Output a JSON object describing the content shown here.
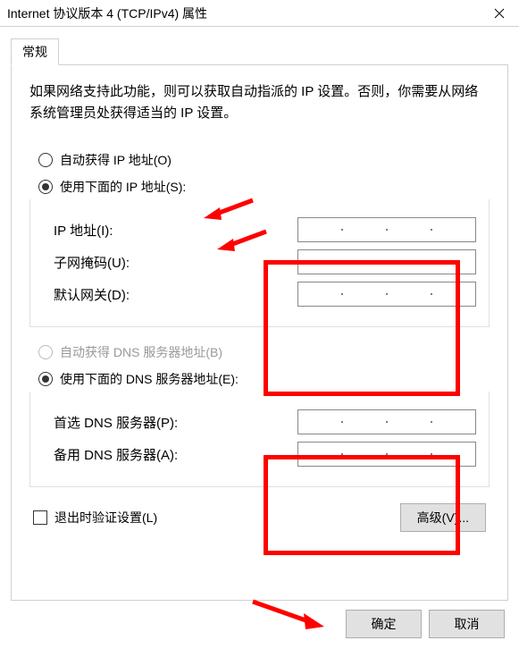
{
  "window": {
    "title": "Internet 协议版本 4 (TCP/IPv4) 属性"
  },
  "tab": {
    "general": "常规"
  },
  "description": "如果网络支持此功能，则可以获取自动指派的 IP 设置。否则，你需要从网络系统管理员处获得适当的 IP 设置。",
  "ip_section": {
    "auto_radio": "自动获得 IP 地址(O)",
    "manual_radio": "使用下面的 IP 地址(S):",
    "ip_address_label": "IP 地址(I):",
    "subnet_label": "子网掩码(U):",
    "gateway_label": "默认网关(D):"
  },
  "dns_section": {
    "auto_radio": "自动获得 DNS 服务器地址(B)",
    "manual_radio": "使用下面的 DNS 服务器地址(E):",
    "primary_label": "首选 DNS 服务器(P):",
    "secondary_label": "备用 DNS 服务器(A):"
  },
  "validate_checkbox": "退出时验证设置(L)",
  "advanced_button": "高级(V)...",
  "ok_button": "确定",
  "cancel_button": "取消"
}
